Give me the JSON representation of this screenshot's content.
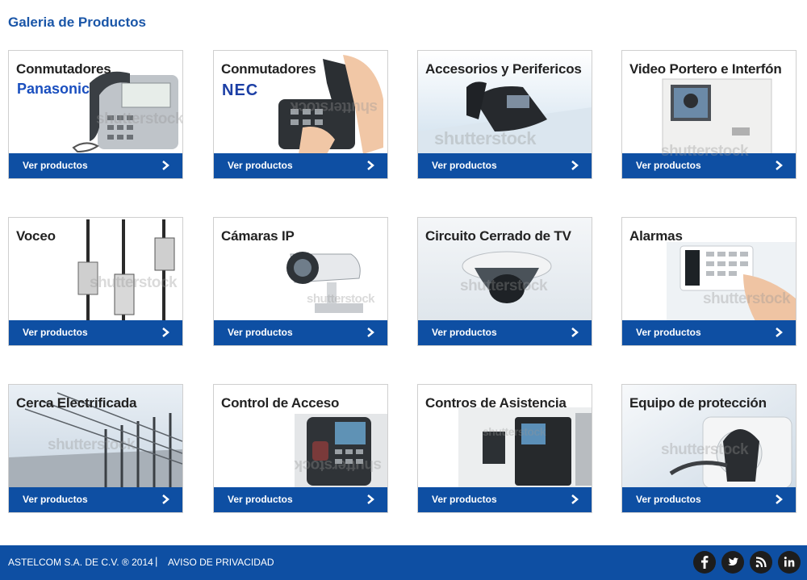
{
  "page": {
    "title": "Galeria de Productos"
  },
  "cards": [
    {
      "title": "Conmutadores",
      "brand": "Panasonic",
      "cta": "Ver productos",
      "watermark": "shutterstock",
      "icon": "desk-phone"
    },
    {
      "title": "Conmutadores",
      "brand": "NEC",
      "cta": "Ver productos",
      "watermark": "shutterstock",
      "icon": "phone-handset"
    },
    {
      "title": "Accesorios y Perifericos",
      "cta": "Ver productos",
      "watermark": "shutterstock",
      "icon": "ip-phone"
    },
    {
      "title": "Video Portero e Interfón",
      "cta": "Ver productos",
      "watermark": "shutterstock",
      "icon": "video-intercom"
    },
    {
      "title": "Voceo",
      "cta": "Ver productos",
      "watermark": "shutterstock",
      "icon": "mixer-faders"
    },
    {
      "title": "Cámaras IP",
      "cta": "Ver productos",
      "watermark": "shutterstock",
      "icon": "bullet-camera"
    },
    {
      "title": "Circuito Cerrado de TV",
      "cta": "Ver productos",
      "watermark": "shutterstock",
      "icon": "dome-camera"
    },
    {
      "title": "Alarmas",
      "cta": "Ver productos",
      "watermark": "shutterstock",
      "icon": "alarm-keypad"
    },
    {
      "title": "Cerca Electrificada",
      "cta": "Ver productos",
      "watermark": "shutterstock",
      "icon": "electric-fence"
    },
    {
      "title": "Control de Acceso",
      "cta": "Ver productos",
      "watermark": "shutterstock",
      "icon": "fingerprint-reader"
    },
    {
      "title": "Contros de Asistencia",
      "cta": "Ver productos",
      "watermark": "shutterstock",
      "icon": "time-clock"
    },
    {
      "title": "Equipo de protección",
      "cta": "Ver productos",
      "watermark": "shutterstock",
      "icon": "power-outlet"
    }
  ],
  "footer": {
    "company": "ASTELCOM S.A. DE C.V. ® 2014",
    "separator": "|",
    "privacy": "AVISO DE PRIVACIDAD",
    "social": [
      "facebook-icon",
      "twitter-icon",
      "rss-icon",
      "linkedin-icon"
    ]
  },
  "colors": {
    "accent": "#0e4fa3",
    "title": "#1a56a8",
    "social_bg": "#1d1d1d"
  }
}
